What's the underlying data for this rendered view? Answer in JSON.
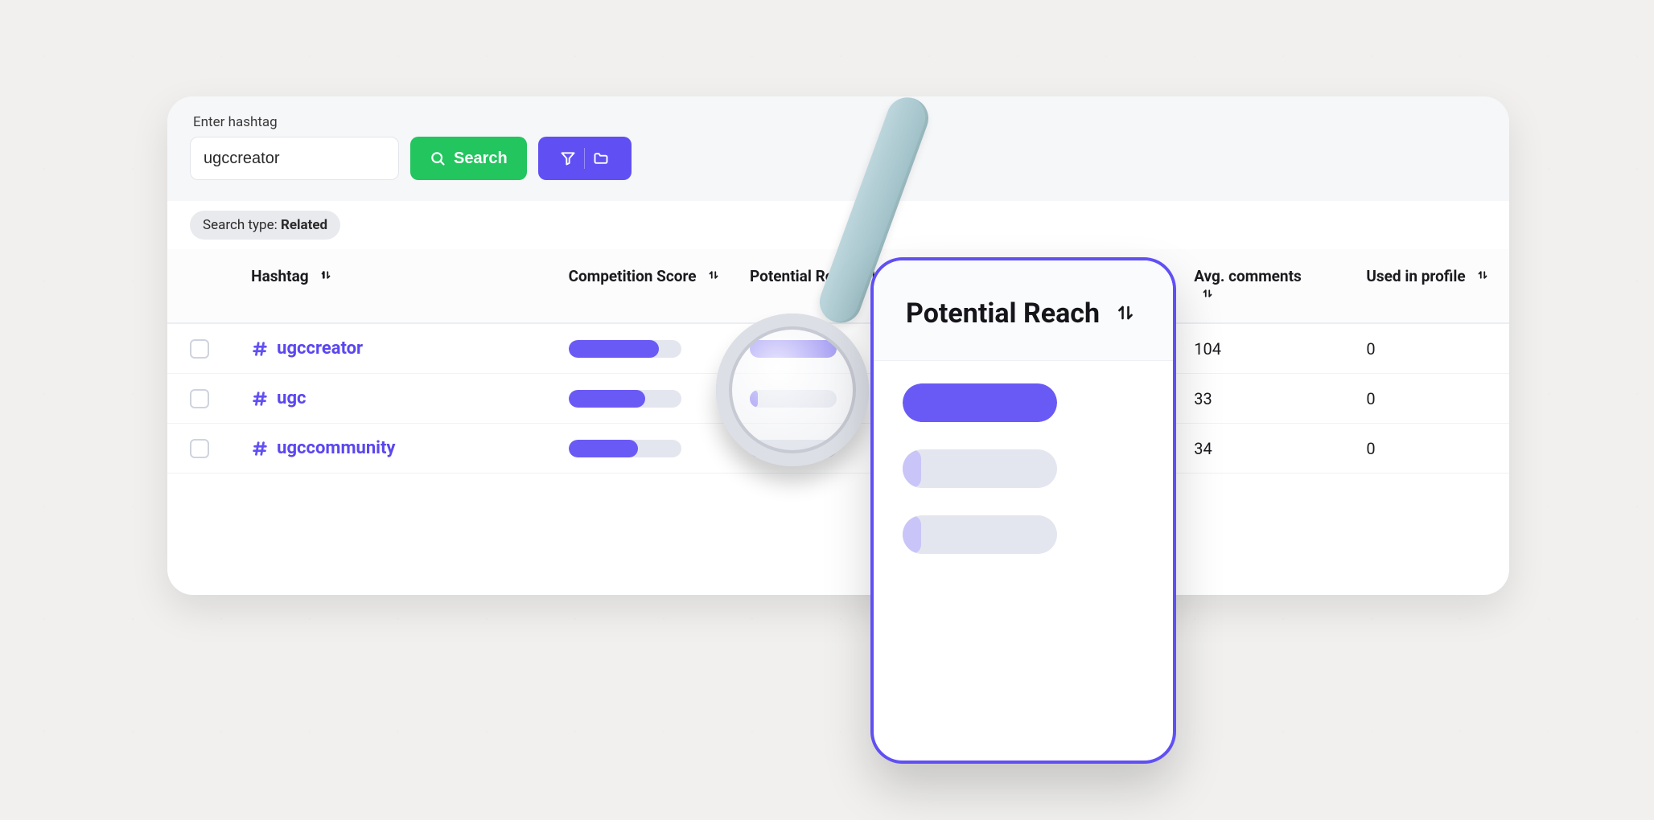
{
  "search": {
    "label": "Enter hashtag",
    "value": "ugccreator",
    "button": "Search"
  },
  "chip": {
    "prefix": "Search type: ",
    "value": "Related"
  },
  "columns": {
    "hashtag": "Hashtag",
    "competition": "Competition Score",
    "reach": "Potential Reach",
    "avg_comments": "Avg. comments",
    "used_in_profile": "Used in profile"
  },
  "rows": [
    {
      "hashtag": "ugccreator",
      "competition": 80,
      "reach": 100,
      "avg_comments": "104",
      "used_in_profile": "0"
    },
    {
      "hashtag": "ugc",
      "competition": 68,
      "reach": 9,
      "avg_comments": "33",
      "used_in_profile": "0"
    },
    {
      "hashtag": "ugccommunity",
      "competition": 62,
      "reach": 9,
      "avg_comments": "34",
      "used_in_profile": "0"
    }
  ],
  "popover": {
    "title": "Potential Reach",
    "bars": [
      {
        "pct": 100,
        "tone": "solid"
      },
      {
        "pct": 12,
        "tone": "light"
      },
      {
        "pct": 12,
        "tone": "light"
      }
    ]
  },
  "colors": {
    "accent": "#6050f3",
    "green": "#22c55e"
  }
}
